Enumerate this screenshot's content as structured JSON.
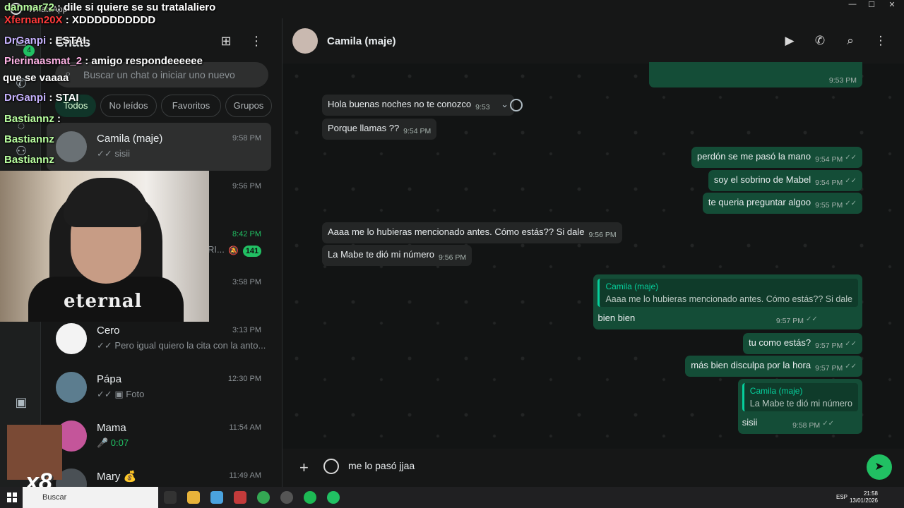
{
  "window": {
    "title": "WhatsApp"
  },
  "rail": {
    "chats_badge": "4"
  },
  "list": {
    "title": "Chats",
    "search_placeholder": "Buscar un chat o iniciar uno nuevo",
    "filters": [
      "Todos",
      "No leídos",
      "Favoritos",
      "Grupos"
    ],
    "active_filter": 0,
    "rows": [
      {
        "name": "Camila (maje)",
        "time": "9:58 PM",
        "preview": "✓✓ sisii",
        "selected": true
      },
      {
        "name": "",
        "time": "9:56 PM",
        "preview": ""
      },
      {
        "name": "",
        "time": "8:42 PM",
        "preview": "RI...",
        "unread": "141",
        "muted": true
      },
      {
        "name": "",
        "time": "3:58 PM",
        "preview": ""
      },
      {
        "name": "Cero",
        "time": "3:13 PM",
        "preview": "✓✓ Pero igual quiero la cita con la anto..."
      },
      {
        "name": "Pápa",
        "time": "12:30 PM",
        "preview": "✓✓ ▣ Foto"
      },
      {
        "name": "Mama",
        "time": "11:54 AM",
        "preview": "🎤 0:07"
      },
      {
        "name": "Mary 💰",
        "time": "11:49 AM",
        "preview": ""
      }
    ]
  },
  "conversation": {
    "contact_name": "Camila (maje)",
    "messages": [
      {
        "dir": "out",
        "text": "",
        "time": "9:53 PM"
      },
      {
        "dir": "in",
        "text": "Hola buenas noches no te conozco",
        "time": "9:53"
      },
      {
        "dir": "in",
        "text": "Porque llamas ??",
        "time": "9:54 PM"
      },
      {
        "dir": "out",
        "text": "perdón se me pasó la mano",
        "time": "9:54 PM"
      },
      {
        "dir": "out",
        "text": "soy el sobrino de Mabel",
        "time": "9:54 PM"
      },
      {
        "dir": "out",
        "text": "te queria preguntar algoo",
        "time": "9:55 PM"
      },
      {
        "dir": "in",
        "text": "Aaaa me lo hubieras mencionado antes. Cómo estás?? Si dale",
        "time": "9:56 PM"
      },
      {
        "dir": "in",
        "text": "La Mabe te dió mi número",
        "time": "9:56 PM"
      },
      {
        "dir": "out",
        "quote_name": "Camila (maje)",
        "quote_text": "Aaaa me lo hubieras mencionado antes. Cómo estás?? Si dale",
        "text": "bien bien",
        "time": "9:57 PM"
      },
      {
        "dir": "out",
        "text": "tu como estás?",
        "time": "9:57 PM"
      },
      {
        "dir": "out",
        "text": "más bien disculpa por la hora",
        "time": "9:57 PM"
      },
      {
        "dir": "out",
        "quote_name": "Camila (maje)",
        "quote_text": "La Mabe te dió mi número",
        "text": "sisii",
        "time": "9:58 PM"
      }
    ],
    "composer_text": "me lo pasó  jjaa"
  },
  "stream_chat": [
    {
      "user": "danmar72",
      "text": "dile si quiere se su tratalaliero"
    },
    {
      "user": "Xfernan20X",
      "text": "XDDDDDDDDDD"
    },
    {
      "user": "DrGanpi",
      "text": "ESTAI"
    },
    {
      "user": "Pierinaasmat_2",
      "text": "amigo respondeeeeee"
    },
    {
      "user": "",
      "text": "que se vaaaa"
    },
    {
      "user": "DrGanpi",
      "text": "STAI"
    },
    {
      "user": "Bastiannz",
      "text": ""
    },
    {
      "user": "Bastiannz",
      "text": ""
    },
    {
      "user": "Bastiannz",
      "text": ""
    }
  ],
  "webcam_shirt_text": "eternal",
  "meme_multiplier": "x8",
  "taskbar": {
    "search_placeholder": "Buscar",
    "lang": "ESP",
    "time": "21:58",
    "date": "13/01/2026"
  },
  "colors": {
    "accent": "#21c063",
    "outgoing_bubble": "#144d37",
    "incoming_bubble": "#242626",
    "background": "#161717"
  }
}
